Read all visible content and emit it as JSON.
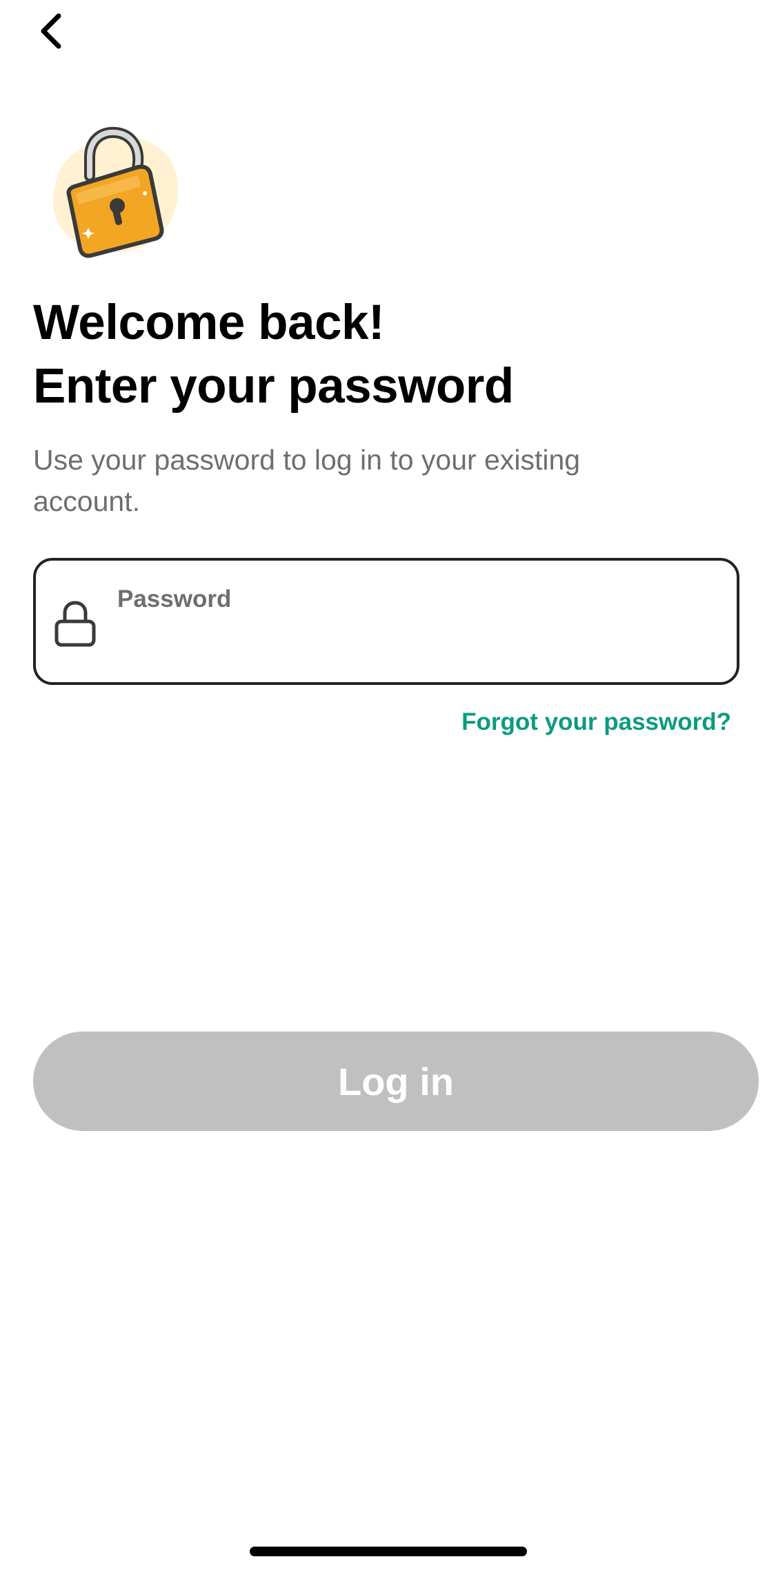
{
  "header": {
    "back_icon": "chevron-left-icon"
  },
  "illustration": {
    "icon": "padlock-illustration",
    "colors": {
      "body": "#F2A623",
      "blob": "#FFF1D1",
      "outline": "#3A3A3A"
    }
  },
  "heading": {
    "line1": "Welcome back!",
    "line2": "Enter your password"
  },
  "subtitle": "Use your password to log in to your existing account.",
  "password_field": {
    "label": "Password",
    "value": "",
    "icon": "lock-icon"
  },
  "forgot_link": "Forgot your password?",
  "login_button": {
    "label": "Log in",
    "enabled": false
  },
  "colors": {
    "accent": "#0B9B7F",
    "button_disabled": "#C0C0C0",
    "text_secondary": "#6E6E6E"
  }
}
